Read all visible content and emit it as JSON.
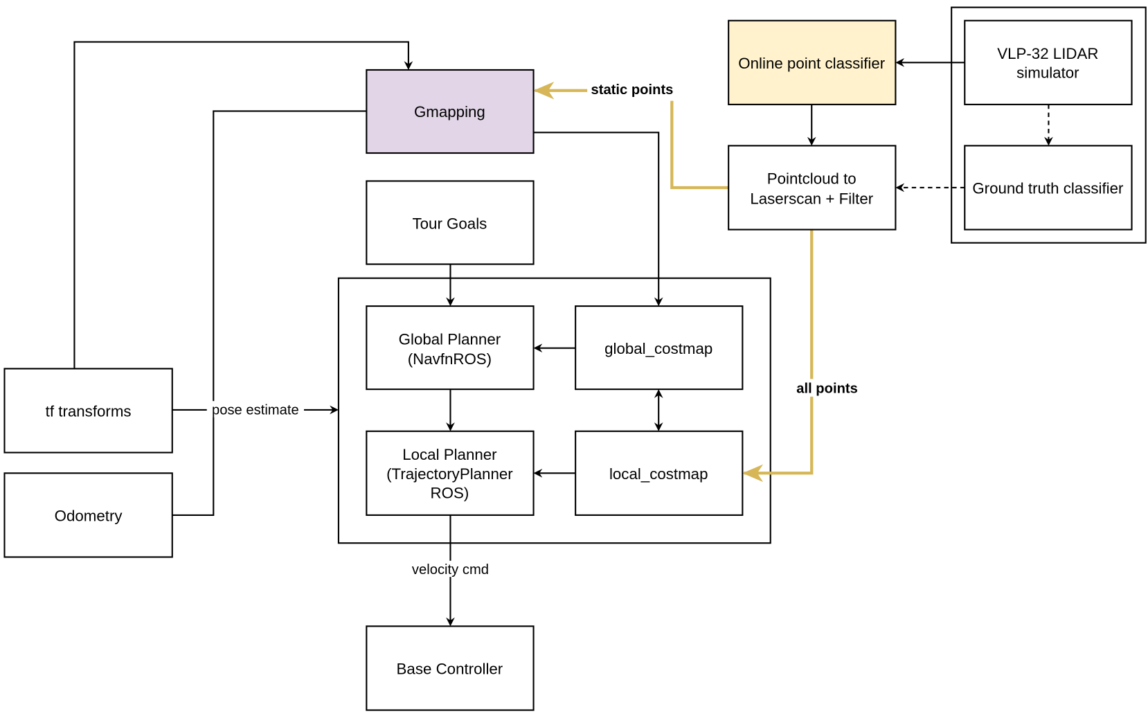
{
  "colors": {
    "gmapping_fill": "#e1d5e7",
    "classifier_fill": "#fff2cc",
    "gold_edge": "#d6b656",
    "stroke": "#000000"
  },
  "nodes": {
    "gmapping": "Gmapping",
    "online_classifier": "Online point classifier",
    "vlp_line1": "VLP-32 LIDAR",
    "vlp_line2": "simulator",
    "ground_truth": "Ground truth classifier",
    "pointcloud_line1": "Pointcloud to",
    "pointcloud_line2": "Laserscan + Filter",
    "tour_goals": "Tour Goals",
    "global_planner_line1": "Global Planner",
    "global_planner_line2": "(NavfnROS)",
    "global_costmap": "global_costmap",
    "local_planner_line1": "Local Planner",
    "local_planner_line2": "(TrajectoryPlanner",
    "local_planner_line3": "ROS)",
    "local_costmap": "local_costmap",
    "tf": "tf transforms",
    "odometry": "Odometry",
    "base_controller": "Base Controller"
  },
  "edge_labels": {
    "static_points": "static points",
    "all_points": "all points",
    "pose_estimate": "pose estimate",
    "velocity_cmd": "velocity cmd"
  }
}
